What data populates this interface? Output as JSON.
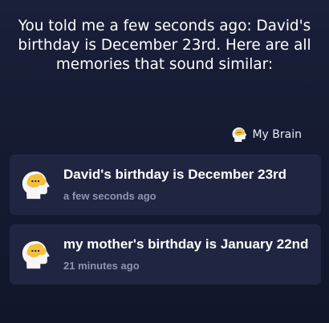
{
  "header": {
    "message": "You told me a few seconds ago: David's birthday is December 23rd. Here are all memories that sound similar:"
  },
  "source": {
    "icon": "brain-icon",
    "label": "My Brain"
  },
  "memories": [
    {
      "icon": "brain-icon",
      "title": "David's birthday is December 23rd",
      "time": "a few seconds ago"
    },
    {
      "icon": "brain-icon",
      "title": "my mother's birthday is January 22nd",
      "time": "21 minutes ago"
    }
  ],
  "colors": {
    "background": "#161b33",
    "card": "#202641",
    "muted_text": "#8e95ad",
    "brain_yellow": "#f4bf3a",
    "head_white": "#f6f6f6"
  }
}
